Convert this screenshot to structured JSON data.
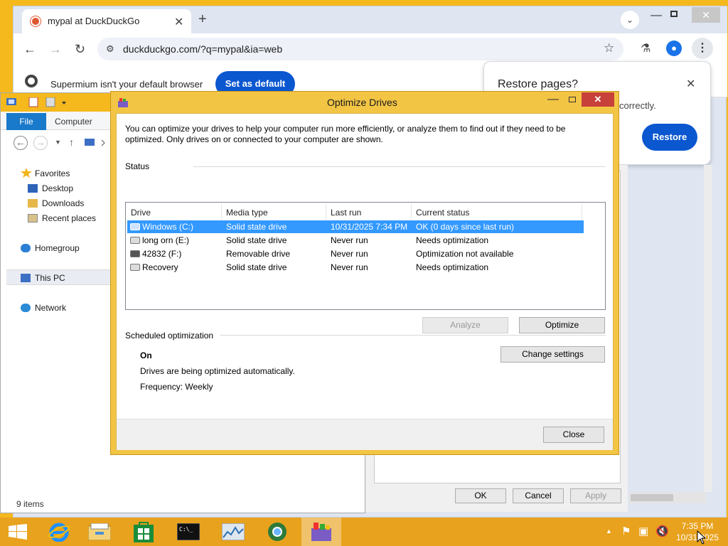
{
  "browser": {
    "tab_title": "mypal at DuckDuckGo",
    "url": "duckduckgo.com/?q=mypal&ia=web",
    "infobar_message": "Supermium isn't your default browser",
    "set_default_label": "Set as default",
    "restore_title": "Restore pages?",
    "restore_body": "correctly.",
    "restore_label": "Restore"
  },
  "explorer": {
    "ribbon_file": "File",
    "ribbon_computer": "Computer",
    "tree": [
      "Favorites",
      "Desktop",
      "Downloads",
      "Recent places",
      "Homegroup",
      "This PC",
      "Network"
    ],
    "status": "9 items"
  },
  "properties_behind": {
    "ok": "OK",
    "cancel": "Cancel",
    "apply": "Apply"
  },
  "optimize": {
    "title": "Optimize Drives",
    "description": "You can optimize your drives to help your computer run more efficiently, or analyze them to find out if they need to be optimized. Only drives on or connected to your computer are shown.",
    "status_label": "Status",
    "columns": [
      "Drive",
      "Media type",
      "Last run",
      "Current status"
    ],
    "drives": [
      {
        "name": "Windows (C:)",
        "media": "Solid state drive",
        "last_run": "10/31/2025 7:34 PM",
        "status": "OK (0 days since last run)",
        "selected": true
      },
      {
        "name": "long orn (E:)",
        "media": "Solid state drive",
        "last_run": "Never run",
        "status": "Needs optimization",
        "selected": false
      },
      {
        "name": "42832 (F:)",
        "media": "Removable drive",
        "last_run": "Never run",
        "status": "Optimization not available",
        "selected": false
      },
      {
        "name": "Recovery",
        "media": "Solid state drive",
        "last_run": "Never run",
        "status": "Needs optimization",
        "selected": false
      }
    ],
    "analyze_label": "Analyze",
    "optimize_label": "Optimize",
    "scheduled_label": "Scheduled optimization",
    "scheduled_state": "On",
    "scheduled_desc": "Drives are being optimized automatically.",
    "frequency": "Frequency: Weekly",
    "change_settings_label": "Change settings",
    "close_label": "Close"
  },
  "taskbar": {
    "time": "7:35 PM",
    "date": "10/31/2025"
  },
  "colors": {
    "desktop_accent": "#f5b91d",
    "selection": "#3399ff",
    "browser_blue": "#0b57d0",
    "close_red": "#c7403a"
  }
}
